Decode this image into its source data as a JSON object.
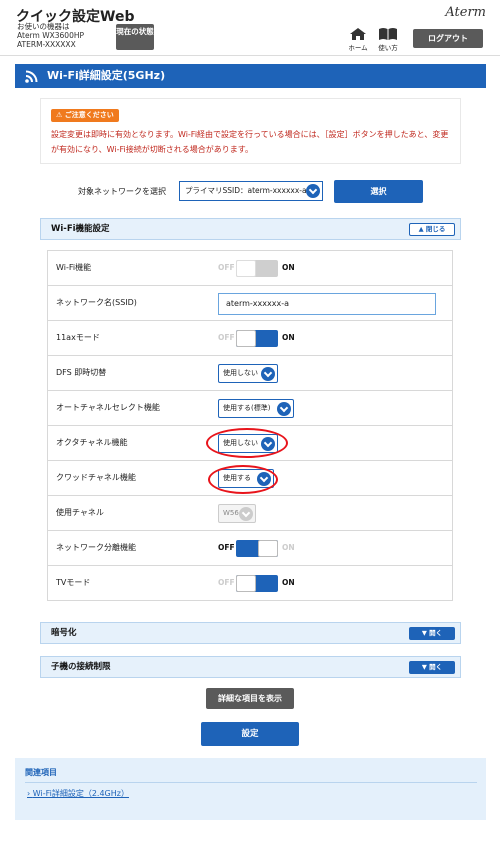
{
  "header": {
    "title": "クイック設定Web",
    "device_caption": "お使いの機器は",
    "device_model": "Aterm WX3600HP",
    "device_name": "ATERM-XXXXXX",
    "status_button": "現在の状態",
    "brand": "Aterm",
    "home_label": "ホーム",
    "help_label": "使い方",
    "logout_label": "ログアウト"
  },
  "page": {
    "title": "Wi-Fi詳細設定(5GHz)"
  },
  "notice": {
    "badge": "ご注意ください",
    "text": "設定変更は即時に有効となります。Wi-Fi経由で設定を行っている場合には、［設定］ボタンを押したあと、変更が有効になり、Wi-Fi接続が切断される場合があります。"
  },
  "network_select": {
    "label": "対象ネットワークを選択",
    "value": "プライマリSSID：aterm-xxxxxx-a",
    "button": "選択"
  },
  "wifi_section": {
    "title": "Wi-Fi機能設定",
    "toggle_label": "閉じる",
    "switch_off": "OFF",
    "switch_on": "ON",
    "rows": [
      {
        "label": "Wi-Fi機能",
        "type": "switch",
        "state": "disabled"
      },
      {
        "label": "ネットワーク名(SSID)",
        "type": "text",
        "value": "aterm-xxxxxx-a"
      },
      {
        "label": "11axモード",
        "type": "switch",
        "state": "on"
      },
      {
        "label": "DFS 即時切替",
        "type": "select",
        "value": "使用しない"
      },
      {
        "label": "オートチャネルセレクト機能",
        "type": "select",
        "value": "使用する(標準)"
      },
      {
        "label": "オクタチャネル機能",
        "type": "select",
        "value": "使用しない"
      },
      {
        "label": "クワッドチャネル機能",
        "type": "select",
        "value": "使用する"
      },
      {
        "label": "使用チャネル",
        "type": "select_disabled",
        "value": "W56"
      },
      {
        "label": "ネットワーク分離機能",
        "type": "switch",
        "state": "off"
      },
      {
        "label": "TVモード",
        "type": "switch",
        "state": "on"
      }
    ]
  },
  "encryption_section": {
    "title": "暗号化",
    "toggle_label": "開く"
  },
  "client_section": {
    "title": "子機の接続制限",
    "toggle_label": "開く"
  },
  "buttons": {
    "details": "詳細な項目を表示",
    "set": "設定"
  },
  "related": {
    "title": "関連項目",
    "link": "Wi-Fi詳細設定（2.4GHz）"
  },
  "colors": {
    "primary": "#1e63b8",
    "dark_button": "#5a5a5a",
    "warning": "#c0281e",
    "badge": "#f07a1e",
    "highlight": "#e8141b"
  }
}
